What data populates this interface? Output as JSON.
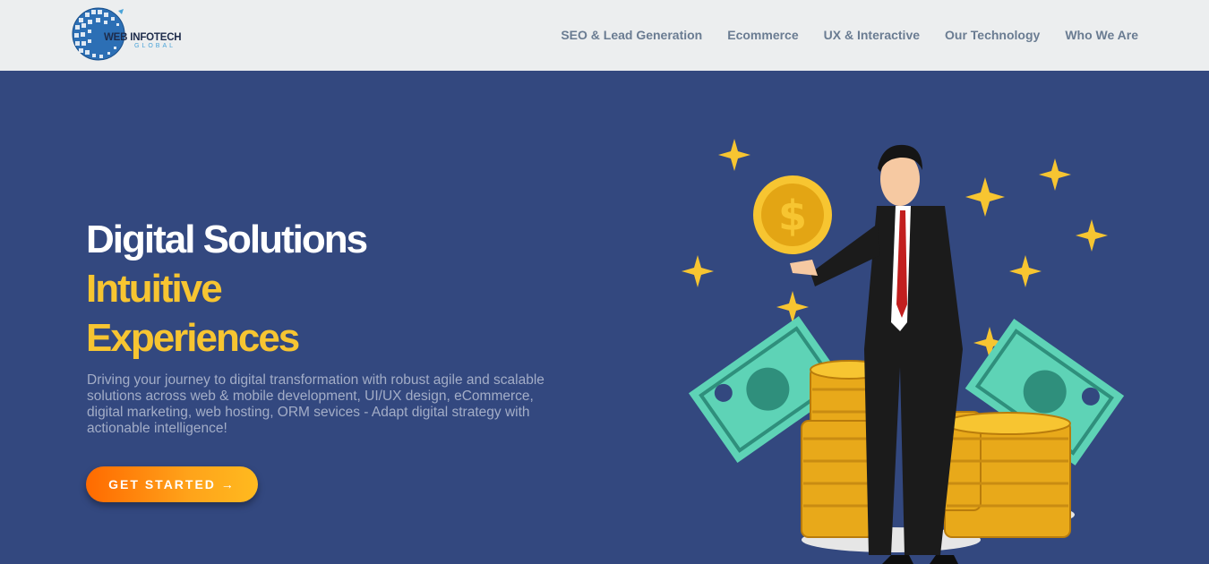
{
  "brand": {
    "name": "WEB INFOTECH",
    "tagline": "GLOBAL"
  },
  "nav": {
    "items": [
      {
        "label": "SEO & Lead Generation"
      },
      {
        "label": "Ecommerce"
      },
      {
        "label": "UX & Interactive"
      },
      {
        "label": "Our Technology"
      },
      {
        "label": "Who We Are"
      }
    ]
  },
  "hero": {
    "line1": "Digital Solutions",
    "line2": "Intuitive",
    "line3": "Experiences",
    "description": "Driving your journey to digital transformation with robust agile and scalable solutions across web & mobile development, UI/UX design, eCommerce, digital marketing, web hosting, ORM sevices - Adapt digital strategy with actionable intelligence!",
    "cta_label": "GET STARTED →",
    "coin_symbol": "$"
  },
  "colors": {
    "nav_bg": "#eceeef",
    "hero_bg": "#33487f",
    "accent_yellow": "#f7c531",
    "cta_orange": "#ff6a00",
    "nav_text": "#6a7c92"
  }
}
